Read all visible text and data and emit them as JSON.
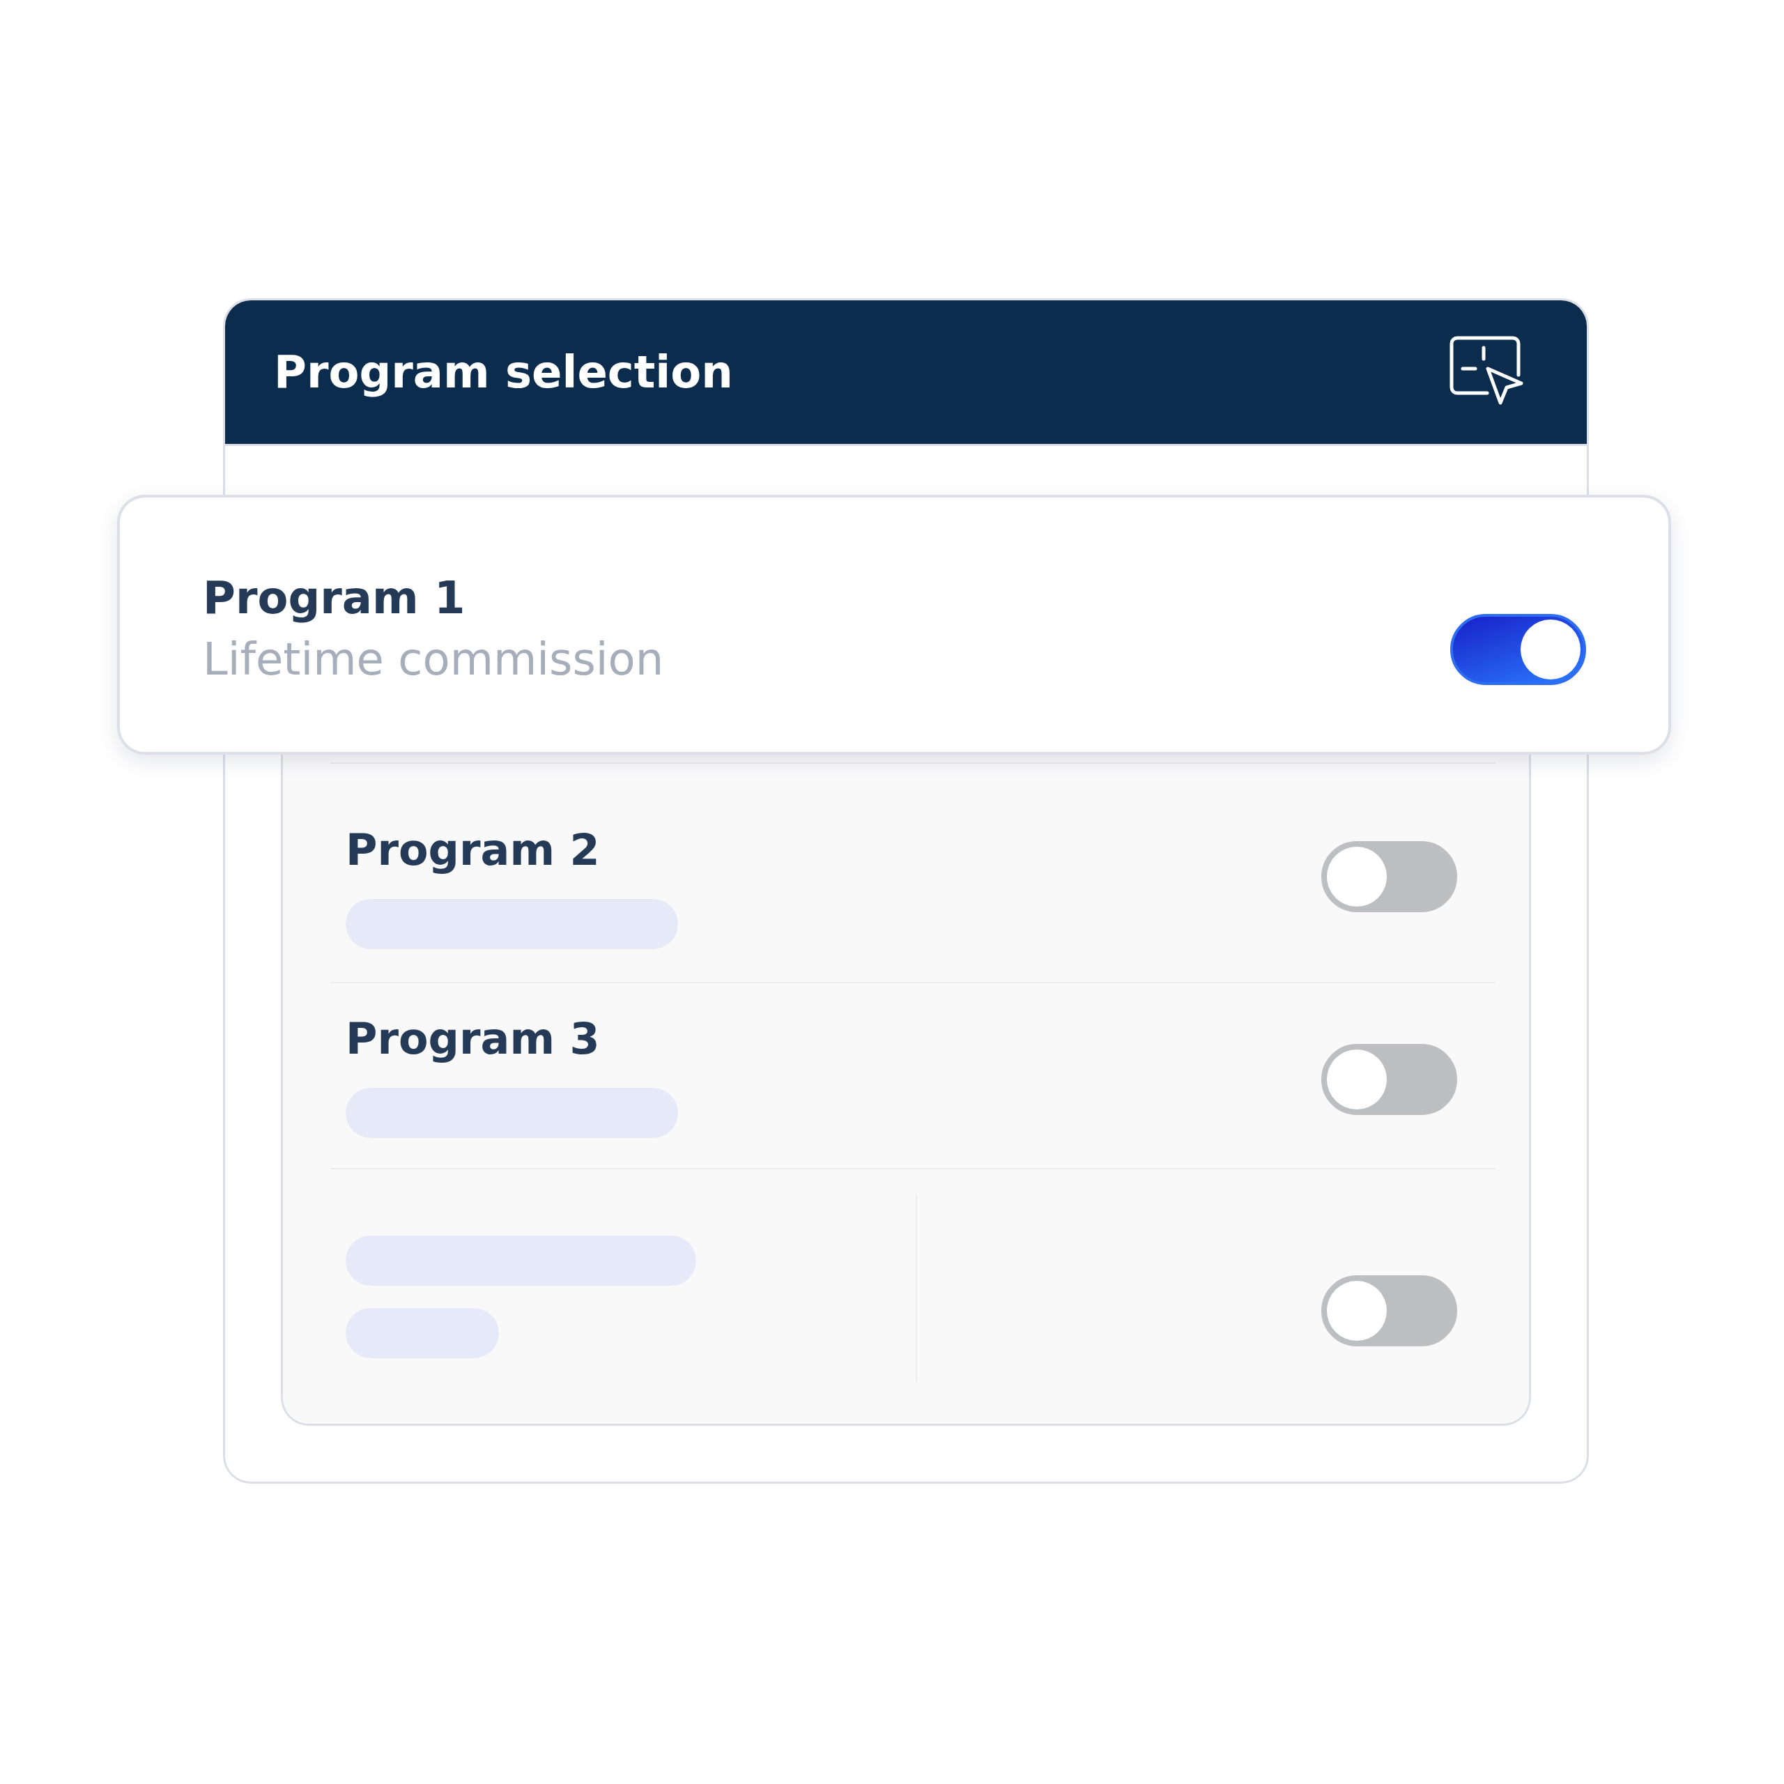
{
  "window": {
    "title": "Program selection"
  },
  "programs": [
    {
      "kind": "card",
      "name": "Program 1",
      "subtitle": "Lifetime commission",
      "on": true
    },
    {
      "kind": "row",
      "name": "Program 2",
      "on": false
    },
    {
      "kind": "row",
      "name": "Program 3",
      "on": false
    },
    {
      "kind": "skeleton",
      "on": false
    }
  ]
}
